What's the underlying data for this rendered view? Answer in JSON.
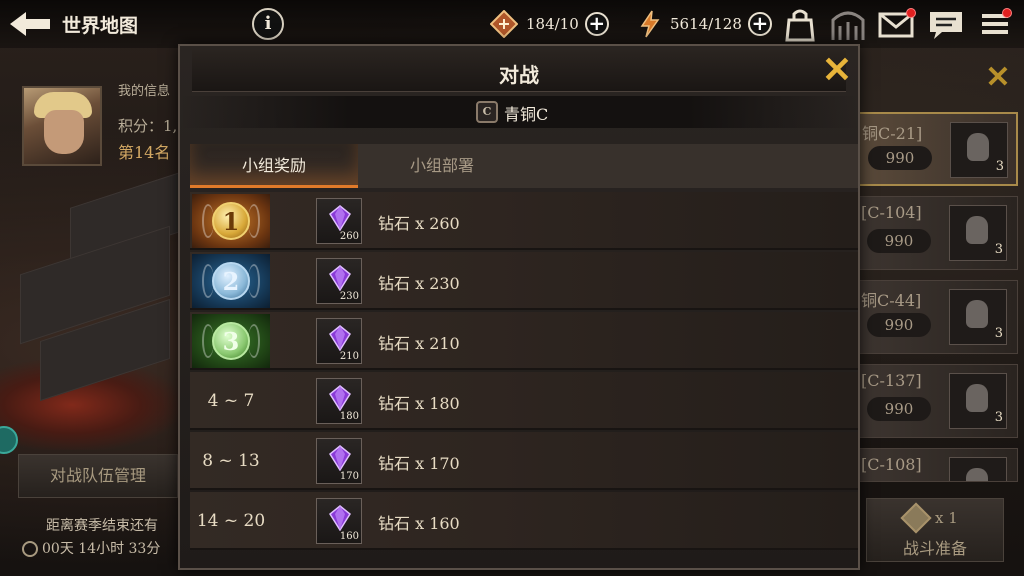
{
  "top_bar": {
    "title": "世界地图",
    "info_label": "i",
    "stamina": "184/10",
    "energy": "5614/128"
  },
  "player": {
    "info_label": "我的信息",
    "score_label": "积分：1,",
    "rank_label": "第14名"
  },
  "left_panel": {
    "team_button": "对战队伍管理",
    "season_label": "距离赛季结束还有",
    "season_time": "00天 14小时 33分"
  },
  "side_list": {
    "items": [
      {
        "name": "铜C-21]",
        "score": "990",
        "count": "3"
      },
      {
        "name": "[C-104]",
        "score": "990",
        "count": "3"
      },
      {
        "name": "铜C-44]",
        "score": "990",
        "count": "3"
      },
      {
        "name": "[C-137]",
        "score": "990",
        "count": "3"
      },
      {
        "name": "[C-108]",
        "score": "",
        "count": ""
      }
    ],
    "battle_prep": {
      "count": "x 1",
      "label": "战斗准备"
    }
  },
  "modal": {
    "title": "对战",
    "league_icon_text": "C",
    "league_name": "青铜C",
    "tabs": [
      {
        "label": "小组奖励",
        "active": true
      },
      {
        "label": "小组部署",
        "active": false
      }
    ],
    "rewards": [
      {
        "rank": "1",
        "style": "gold",
        "gem_qty": "260",
        "text": "钻石 x 260"
      },
      {
        "rank": "2",
        "style": "blue",
        "gem_qty": "230",
        "text": "钻石 x 230"
      },
      {
        "rank": "3",
        "style": "green",
        "gem_qty": "210",
        "text": "钻石 x 210"
      },
      {
        "rank": "4 ~ 7",
        "style": "plain",
        "gem_qty": "180",
        "text": "钻石 x 180"
      },
      {
        "rank": "8 ~ 13",
        "style": "plain",
        "gem_qty": "170",
        "text": "钻石 x 170"
      },
      {
        "rank": "14 ~ 20",
        "style": "plain",
        "gem_qty": "160",
        "text": "钻石 x 160"
      }
    ]
  },
  "colors": {
    "accent_close": "#e8b43a",
    "tab_underline": "#e07a2a",
    "gem": "#8a3ad8",
    "notification": "#e02020"
  },
  "icons": [
    "back-arrow-icon",
    "info-icon",
    "stamina-icon",
    "plus-icon",
    "energy-icon",
    "bag-icon",
    "gate-icon",
    "mail-icon",
    "chat-icon",
    "menu-icon",
    "close-icon",
    "league-badge-icon",
    "gem-icon",
    "helmet-icon",
    "clock-icon"
  ]
}
